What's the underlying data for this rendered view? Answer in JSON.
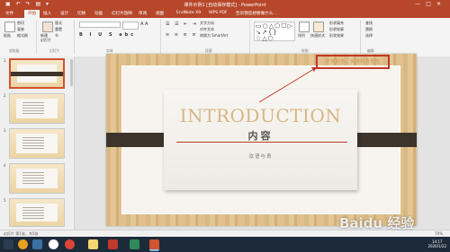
{
  "window": {
    "title": "课件示例1 [自动保存模式] - PowerPoint",
    "controls": [
      "—",
      "□",
      "✕"
    ]
  },
  "tabs": [
    {
      "label": "文件",
      "active": false
    },
    {
      "label": "开始",
      "active": true
    },
    {
      "label": "插入",
      "active": false
    },
    {
      "label": "设计",
      "active": false
    },
    {
      "label": "切换",
      "active": false
    },
    {
      "label": "动画",
      "active": false
    },
    {
      "label": "幻灯片放映",
      "active": false
    },
    {
      "label": "审阅",
      "active": false
    },
    {
      "label": "视图",
      "active": false
    },
    {
      "label": "EndNote X9",
      "active": false
    },
    {
      "label": "WPS PDF",
      "active": false
    },
    {
      "label": "告诉我您想要做什么...",
      "active": false
    }
  ],
  "ribbon": {
    "paste": "粘贴",
    "cut": "剪切",
    "copy": "复制",
    "format_painter": "格式刷",
    "new_slide": "新建\n幻灯片",
    "layout": "版式",
    "reset": "重置",
    "section": "节",
    "font_name": "",
    "text_direction": "文字方向",
    "align_text": "对齐文本",
    "smartart": "转换为 SmartArt",
    "arrange": "排列",
    "quick_styles": "快速样式",
    "shape_fill": "形状填充",
    "shape_outline": "形状轮廓",
    "shape_effects": "形状效果",
    "find": "查找",
    "replace": "替换",
    "select": "选择",
    "groups": {
      "clipboard": "剪贴板",
      "slides": "幻灯片",
      "font": "字体",
      "paragraph": "段落",
      "drawing": "绘图",
      "editing": "编辑"
    }
  },
  "thumbnails": [
    {
      "num": "1",
      "selected": true
    },
    {
      "num": "2",
      "selected": false
    },
    {
      "num": "3",
      "selected": false
    },
    {
      "num": "4",
      "selected": false
    },
    {
      "num": "5",
      "selected": false
    }
  ],
  "slide": {
    "title": "INTRODUCTION",
    "heading": "内容",
    "subtitle": "汝语与青",
    "note": "字体颜色，保持和背景色"
  },
  "statusbar": {
    "left": "幻灯片 第1张，共5张",
    "zoom": "70%"
  },
  "taskbar": {
    "time": "14:17",
    "date": "2020/1/22"
  },
  "watermark": "Baidu 经验"
}
